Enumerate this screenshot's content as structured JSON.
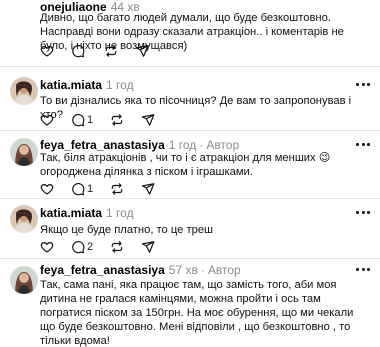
{
  "posts": [
    {
      "username": "onejuliaone",
      "time": "44 хв",
      "author_tag": "",
      "text": "Дивно, що багато людей думали, що буде безкоштовно. Насправді вони одразу сказали атракціон.. і коментарів не було, і ніхто не возмущався)",
      "reply_count": ""
    },
    {
      "username": "katia.miata",
      "time": "1 год",
      "author_tag": "",
      "text": "То ви дізнались яка то пісочниця? Де вам то запропонував і хто?",
      "reply_count": "1"
    },
    {
      "username": "feya_fetra_anastasiya",
      "time": "1 год",
      "author_tag": "Автор",
      "text": "Так, біля атракціонів , чи то і є атракціон для менших 😉 огороджена ділянка з піском і іграшками.",
      "reply_count": "1"
    },
    {
      "username": "katia.miata",
      "time": "1 год",
      "author_tag": "",
      "text": "Якщо це буде платно, то це треш",
      "reply_count": "2"
    },
    {
      "username": "feya_fetra_anastasiya",
      "time": "57 хв",
      "author_tag": "Автор",
      "text": "Так, сама пані, яка працює там, що замість того, аби моя дитина не гралася камінцями, можна пройти і ось там погратися піском за 150грн. На моє обурення, що ми чекали що буде безкоштовно. Мені відповіли , що безкоштовно , то тільки вдома!",
      "reply_count": ""
    }
  ]
}
